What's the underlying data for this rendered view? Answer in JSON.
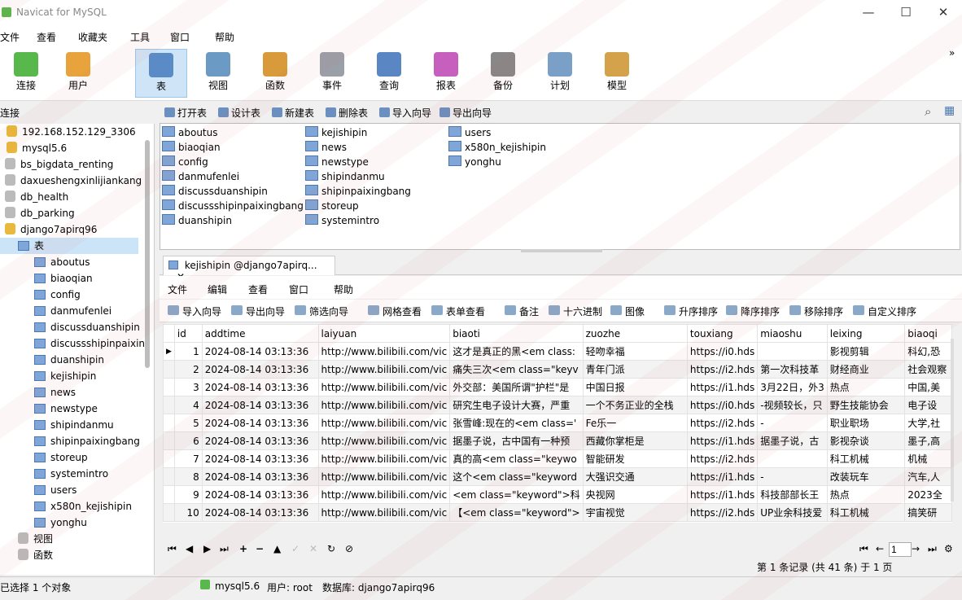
{
  "window": {
    "title": "Navicat for MySQL",
    "minimize": "—",
    "maximize": "☐",
    "close": "✕"
  },
  "menu": [
    "文件",
    "查看",
    "收藏夹",
    "工具",
    "窗口",
    "帮助"
  ],
  "toolbar": [
    {
      "label": "连接",
      "icon": "connection-icon",
      "color": "#58b84c"
    },
    {
      "label": "用户",
      "icon": "user-icon",
      "color": "#e8a33c"
    },
    {
      "label": "表",
      "icon": "table-icon",
      "color": "#5b8bc6"
    },
    {
      "label": "视图",
      "icon": "view-icon",
      "color": "#6b9ac4"
    },
    {
      "label": "函数",
      "icon": "function-icon",
      "color": "#d89a3a"
    },
    {
      "label": "事件",
      "icon": "event-icon",
      "color": "#9aa0a8"
    },
    {
      "label": "查询",
      "icon": "query-icon",
      "color": "#5a87c3"
    },
    {
      "label": "报表",
      "icon": "report-icon",
      "color": "#c75fbf"
    },
    {
      "label": "备份",
      "icon": "backup-icon",
      "color": "#888"
    },
    {
      "label": "计划",
      "icon": "schedule-icon",
      "color": "#7ba0c8"
    },
    {
      "label": "模型",
      "icon": "model-icon",
      "color": "#d4a24a"
    }
  ],
  "objbar": [
    "打开表",
    "设计表",
    "新建表",
    "删除表",
    "导入向导",
    "导出向导"
  ],
  "sidebar": {
    "label": "连接",
    "items": [
      {
        "text": "192.168.152.129_3306",
        "level": 0,
        "kind": "conn"
      },
      {
        "text": "mysql5.6",
        "level": 0,
        "kind": "conn"
      },
      {
        "text": "bs_bigdata_renting",
        "level": 1,
        "kind": "db"
      },
      {
        "text": "daxueshengxinlijiankang",
        "level": 1,
        "kind": "db"
      },
      {
        "text": "db_health",
        "level": 1,
        "kind": "db"
      },
      {
        "text": "db_parking",
        "level": 1,
        "kind": "db"
      },
      {
        "text": "django7apirq96",
        "level": 1,
        "kind": "dbopen"
      },
      {
        "text": "表",
        "level": 2,
        "kind": "tables"
      },
      {
        "text": "aboutus",
        "level": 3,
        "kind": "table"
      },
      {
        "text": "biaoqian",
        "level": 3,
        "kind": "table"
      },
      {
        "text": "config",
        "level": 3,
        "kind": "table"
      },
      {
        "text": "danmufenlei",
        "level": 3,
        "kind": "table"
      },
      {
        "text": "discussduanshipin",
        "level": 3,
        "kind": "table"
      },
      {
        "text": "discussshipinpaixingbang",
        "level": 3,
        "kind": "table"
      },
      {
        "text": "duanshipin",
        "level": 3,
        "kind": "table"
      },
      {
        "text": "kejishipin",
        "level": 3,
        "kind": "table"
      },
      {
        "text": "news",
        "level": 3,
        "kind": "table"
      },
      {
        "text": "newstype",
        "level": 3,
        "kind": "table"
      },
      {
        "text": "shipindanmu",
        "level": 3,
        "kind": "table"
      },
      {
        "text": "shipinpaixingbang",
        "level": 3,
        "kind": "table"
      },
      {
        "text": "storeup",
        "level": 3,
        "kind": "table"
      },
      {
        "text": "systemintro",
        "level": 3,
        "kind": "table"
      },
      {
        "text": "users",
        "level": 3,
        "kind": "table"
      },
      {
        "text": "x580n_kejishipin",
        "level": 3,
        "kind": "table"
      },
      {
        "text": "yonghu",
        "level": 3,
        "kind": "table"
      },
      {
        "text": "视图",
        "level": 2,
        "kind": "view"
      },
      {
        "text": "函数",
        "level": 2,
        "kind": "func"
      }
    ]
  },
  "objects": [
    [
      "aboutus",
      "biaoqian",
      "config",
      "danmufenlei",
      "discussduanshipin",
      "discussshipinpaixingbang",
      "duanshipin"
    ],
    [
      "kejishipin",
      "news",
      "newstype",
      "shipindanmu",
      "shipinpaixingbang",
      "storeup",
      "systemintro"
    ],
    [
      "users",
      "x580n_kejishipin",
      "yonghu"
    ]
  ],
  "tab": {
    "title": "kejishipin @django7apirq...",
    "close": "✕"
  },
  "submenu": [
    "文件",
    "编辑",
    "查看",
    "窗口",
    "帮助"
  ],
  "subtool": [
    "导入向导",
    "导出向导",
    "筛选向导",
    "网格查看",
    "表单查看",
    "备注",
    "十六进制",
    "图像",
    "升序排序",
    "降序排序",
    "移除排序",
    "自定义排序"
  ],
  "grid": {
    "columns": [
      "id",
      "addtime",
      "laiyuan",
      "biaoti",
      "zuozhe",
      "touxiang",
      "miaoshu",
      "leixing",
      "biaoqi"
    ],
    "rows": [
      [
        "1",
        "2024-08-14 03:13:36",
        "http://www.bilibili.com/vic",
        "这才是真正的黑<em class:",
        "轻吻幸福",
        "https://i0.hds",
        "",
        "影视剪辑",
        "科幻,恐"
      ],
      [
        "2",
        "2024-08-14 03:13:36",
        "http://www.bilibili.com/vic",
        "痛失三次<em class=\"keyv",
        "青年门派",
        "https://i2.hds",
        "第一次科技革",
        "财经商业",
        "社会观察"
      ],
      [
        "3",
        "2024-08-14 03:13:36",
        "http://www.bilibili.com/vic",
        "外交部：美国所谓\"护栏\"是",
        "中国日报",
        "https://i1.hds",
        "3月22日，外3",
        "热点",
        "中国,美"
      ],
      [
        "4",
        "2024-08-14 03:13:36",
        "http://www.bilibili.com/vic",
        "研究生电子设计大赛，严重",
        "一个不务正业的全栈",
        "https://i0.hds",
        "-视频较长，只",
        "野生技能协会",
        "电子设"
      ],
      [
        "5",
        "2024-08-14 03:13:36",
        "http://www.bilibili.com/vic",
        "张雪峰:现在的<em class='",
        "Fe乐一",
        "https://i2.hds",
        "-",
        "职业职场",
        "大学,社"
      ],
      [
        "6",
        "2024-08-14 03:13:36",
        "http://www.bilibili.com/vic",
        "据墨子说，古中国有一种预",
        "西藏你掌柜是",
        "https://i1.hds",
        "据墨子说，古",
        "影视杂谈",
        "墨子,高"
      ],
      [
        "7",
        "2024-08-14 03:13:36",
        "http://www.bilibili.com/vic",
        "真的高<em class=\"keywo",
        "智能研发",
        "https://i2.hds",
        "",
        "科工机械",
        "机械"
      ],
      [
        "8",
        "2024-08-14 03:13:36",
        "http://www.bilibili.com/vic",
        "这个<em class=\"keyword",
        "大强识交通",
        "https://i1.hds",
        "-",
        "改装玩车",
        "汽车,人"
      ],
      [
        "9",
        "2024-08-14 03:13:36",
        "http://www.bilibili.com/vic",
        "<em class=\"keyword\">科",
        "央视网",
        "https://i1.hds",
        "科技部部长王",
        "热点",
        "2023全"
      ],
      [
        "10",
        "2024-08-14 03:13:36",
        "http://www.bilibili.com/vic",
        "【<em class=\"keyword\">",
        "宇宙视觉",
        "https://i2.hds",
        "UP业余科技爱",
        "科工机械",
        "搞笑研"
      ]
    ]
  },
  "nav": {
    "page": "1",
    "record_info": "第 1 条记录 (共 41 条) 于 1 页"
  },
  "status": {
    "selected": "已选择 1 个对象",
    "connection": "mysql5.6",
    "user": "用户: root",
    "database": "数据库: django7apirq96"
  }
}
